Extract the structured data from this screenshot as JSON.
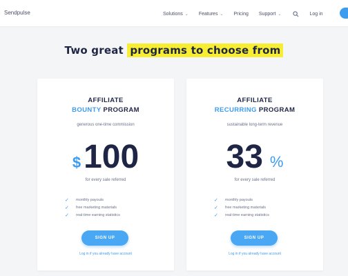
{
  "nav": {
    "brand": "Sendpulse",
    "items": [
      {
        "label": "Solutions",
        "caret": "⌄"
      },
      {
        "label": "Features",
        "caret": "⌄"
      },
      {
        "label": "Pricing",
        "caret": ""
      },
      {
        "label": "Support",
        "caret": "⌄"
      }
    ],
    "login": "Log in",
    "search_icon": "search-icon"
  },
  "headline": {
    "prefix": "Two great ",
    "highlight": "programs to choose from",
    "highlight_color": "#f7ee33"
  },
  "accent_color": "#3d9bf0",
  "cards": [
    {
      "title_line1": "AFFILIATE",
      "title_accent": "BOUNTY",
      "title_rest": " PROGRAM",
      "subtitle": "generous one-time commission",
      "currency": "$",
      "amount": "100",
      "unit": "",
      "per": "for every sale referred",
      "features": [
        "monthly payouts",
        "free marketing materials",
        "real-time earning statistics"
      ],
      "button": "SIGN UP",
      "link": "Log in if you already have account"
    },
    {
      "title_line1": "AFFILIATE",
      "title_accent": "RECURRING",
      "title_rest": " PROGRAM",
      "subtitle": "sustainable long-term revenue",
      "currency": "",
      "amount": "33",
      "unit": "%",
      "per": "for every sale referred",
      "features": [
        "monthly payouts",
        "free marketing materials",
        "real-time earning statistics"
      ],
      "button": "SIGN UP",
      "link": "Log in if you already have account"
    }
  ]
}
